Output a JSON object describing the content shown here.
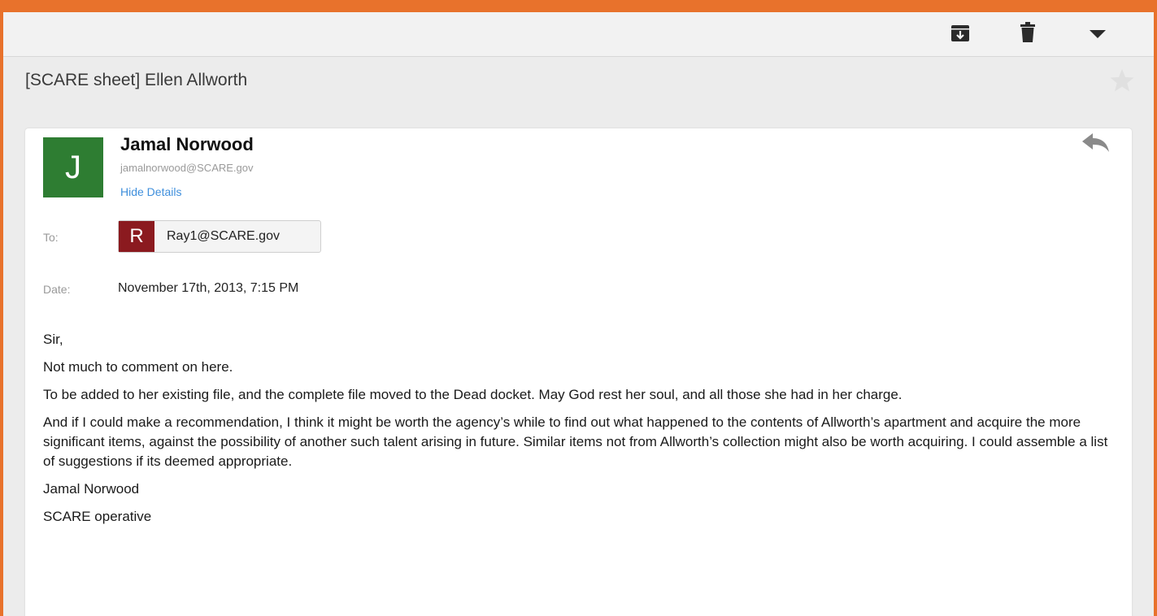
{
  "toolbar": {
    "archive_icon": "archive-icon",
    "delete_icon": "trash-icon",
    "more_icon": "chevron-down-icon"
  },
  "message": {
    "subject": "[SCARE sheet] Ellen Allworth",
    "sender": {
      "initial": "J",
      "name": "Jamal Norwood",
      "email": "jamalnorwood@SCARE.gov",
      "avatar_color": "#2e7d32"
    },
    "hide_details_label": "Hide Details",
    "to_label": "To:",
    "recipient": {
      "initial": "R",
      "email": "Ray1@SCARE.gov",
      "avatar_color": "#8b1a1f"
    },
    "date_label": "Date:",
    "date_value": "November 17th, 2013, 7:15 PM",
    "body": [
      "Sir,",
      "Not much to comment on here.",
      "To be added to her existing file, and the complete file moved to the Dead docket. May God rest her soul, and all those she had in her charge.",
      "And if I could make a recommendation, I think it might be worth the agency’s while to find out what happened to the contents of Allworth’s apartment and acquire the more significant items, against the possibility of another such talent arising in future. Similar items not from Allworth’s collection might also be worth acquiring. I could assemble a list of suggestions if its deemed appropriate.",
      "Jamal Norwood",
      "SCARE operative"
    ]
  },
  "colors": {
    "frame_accent": "#e8722c",
    "link": "#3f8fdc"
  }
}
